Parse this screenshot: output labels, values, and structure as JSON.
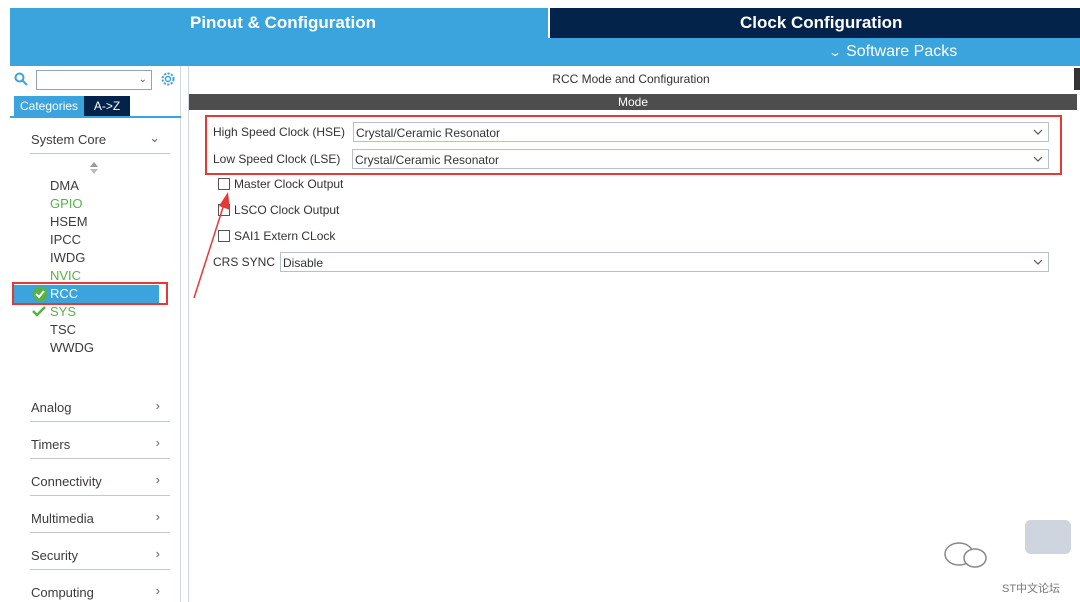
{
  "tabs": {
    "pinout": "Pinout & Configuration",
    "clock": "Clock Configuration",
    "software_packs": "Software Packs"
  },
  "sidebar": {
    "search_value": "",
    "category_tabs": [
      "Categories",
      "A->Z"
    ],
    "groups": [
      "System Core",
      "Analog",
      "Timers",
      "Connectivity",
      "Multimedia",
      "Security",
      "Computing"
    ],
    "peripherals": [
      {
        "label": "DMA",
        "status": "normal"
      },
      {
        "label": "GPIO",
        "status": "green"
      },
      {
        "label": "HSEM",
        "status": "normal"
      },
      {
        "label": "IPCC",
        "status": "normal"
      },
      {
        "label": "IWDG",
        "status": "normal"
      },
      {
        "label": "NVIC",
        "status": "green"
      },
      {
        "label": "RCC",
        "status": "selected"
      },
      {
        "label": "SYS",
        "status": "checked"
      },
      {
        "label": "TSC",
        "status": "normal"
      },
      {
        "label": "WWDG",
        "status": "normal"
      }
    ]
  },
  "main": {
    "title": "RCC Mode and Configuration",
    "mode_header": "Mode",
    "hse_label": "High Speed Clock (HSE)",
    "hse_value": "Crystal/Ceramic Resonator",
    "lse_label": "Low Speed Clock (LSE)",
    "lse_value": "Crystal/Ceramic Resonator",
    "mco_label": "Master Clock Output",
    "lsco_label": "LSCO Clock Output",
    "sai1_label": "SAI1 Extern CLock",
    "crs_label": "CRS SYNC",
    "crs_value": "Disable"
  },
  "watermark": {
    "brand": "ST中文论坛"
  },
  "colors": {
    "accent": "#3ba4dc",
    "dark_tab": "#03234b",
    "ok_green": "#56b246",
    "annotation_red": "#e53935"
  }
}
